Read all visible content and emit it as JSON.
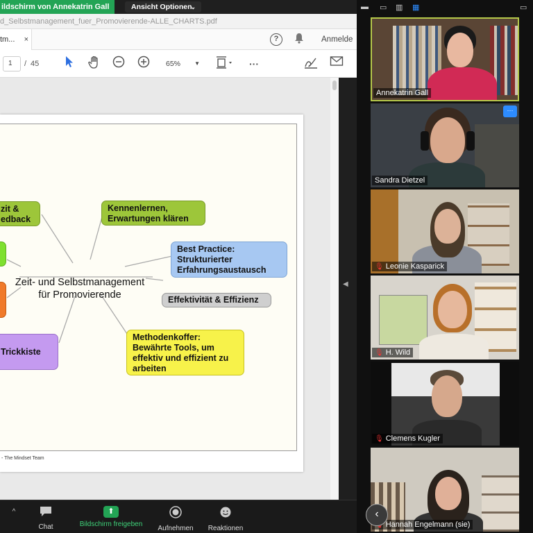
{
  "share_bar": {
    "badge": "ildschirm von Annekatrin Gall",
    "view_options": "Ansicht Optionen"
  },
  "pdf": {
    "title": "d_Selbstmanagement_fuer_Promovierende-ALLE_CHARTS.pdf",
    "tab_label": "tm...",
    "tab_close": "×",
    "signin": "Anmelde",
    "page_current": "1",
    "page_sep": "/",
    "page_total": "45",
    "zoom": "65%"
  },
  "mindmap": {
    "center": "Zeit- und Selbstmanagement für Promovierende",
    "nodes": {
      "zeit_feedback": "zit & edback",
      "kennenlernen": "Kennenlernen, Erwartungen klären",
      "best_practice": "Best Practice: Strukturierter Erfahrungsaustausch",
      "effektivitaet": "Effektivität & Effizienz",
      "methodenkoffer": "Methodenkoffer: Bewährte Tools, um effektiv und effizient zu arbeiten",
      "trickkiste": "Trickkiste"
    },
    "credit": "- The Mindset Team",
    "colors": {
      "green": "#9dc63a",
      "bright_green": "#7ee02f",
      "blue": "#a7c8f2",
      "gray": "#cfcfcf",
      "yellow": "#f7f24a",
      "purple": "#c49af0",
      "orange": "#f07a2a"
    }
  },
  "bottom_bar": {
    "chat": "Chat",
    "share": "Bildschirm freigeben",
    "record": "Aufnehmen",
    "reactions": "Reaktionen"
  },
  "participants": [
    {
      "name": "Annekatrin Gall",
      "muted": false,
      "active": true
    },
    {
      "name": "Sandra Dietzel",
      "muted": false,
      "active": false
    },
    {
      "name": "Leonie Kasparick",
      "muted": true,
      "active": false
    },
    {
      "name": "H. Wild",
      "muted": true,
      "active": false
    },
    {
      "name": "Clemens Kugler",
      "muted": true,
      "active": false
    },
    {
      "name": "Hannah Engelmann (sie)",
      "muted": true,
      "active": false
    }
  ],
  "panel_icons": [
    "minimize-icon",
    "restore-icon",
    "grid-view-icon",
    "more-view-icon"
  ],
  "accent_color": "#23a455"
}
